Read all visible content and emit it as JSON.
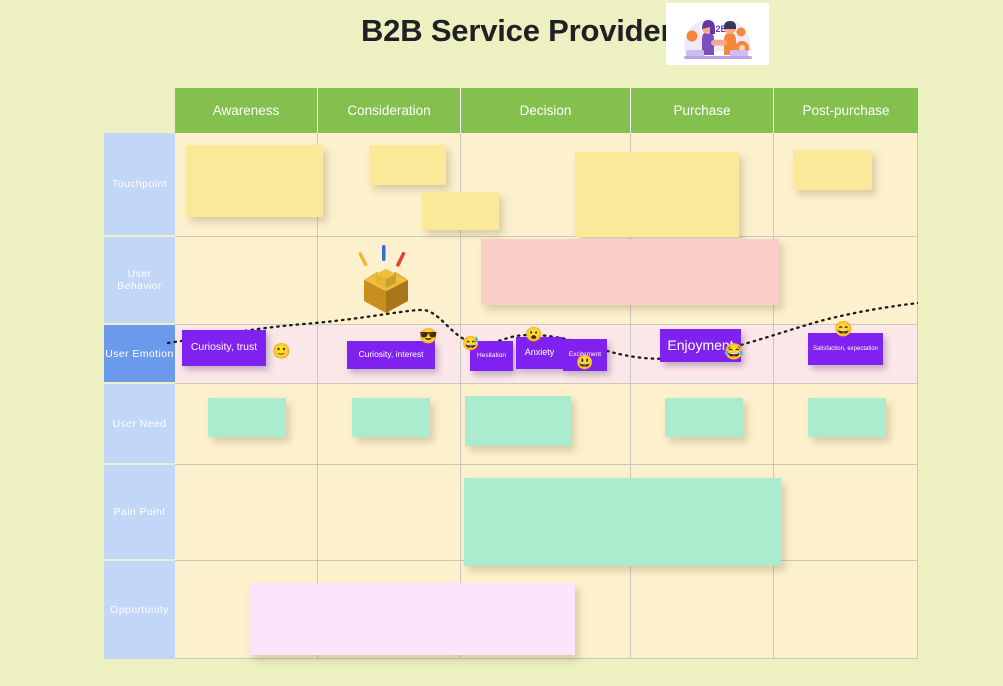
{
  "header": {
    "title": "B2B Service Provider",
    "logo_alt": "b2b-handshake-illustration",
    "logo_text": "B2B"
  },
  "board": {
    "columns": [
      {
        "label": "Awareness"
      },
      {
        "label": "Consideration"
      },
      {
        "label": "Decision"
      },
      {
        "label": "Purchase"
      },
      {
        "label": "Post-purchase"
      }
    ],
    "rows": [
      {
        "label": "Touchpoint",
        "active": false
      },
      {
        "label": "User  Behavior",
        "active": false
      },
      {
        "label": "User  Emotion",
        "active": true
      },
      {
        "label": "User  Need",
        "active": false
      },
      {
        "label": "Pain  Point",
        "active": false
      },
      {
        "label": "Opportunity",
        "active": false
      }
    ],
    "colors": {
      "canvas": "#edf0c0",
      "column_header": "#84c04e",
      "row_label": "#c2d6f8",
      "row_label_active": "#6b9aec",
      "cell": "#fdf0cd",
      "cell_emotion": "#fbe7e7",
      "note_yellow": "#fce899",
      "note_mint": "#abeccf",
      "note_pink": "#fbcdc8",
      "note_lavender": "#fde4fd",
      "emotion_card": "#7f22ef",
      "grid_line": "#c9c9be"
    }
  },
  "notes": {
    "touchpoint": [
      {
        "text": ""
      },
      {
        "text": ""
      },
      {
        "text": ""
      },
      {
        "text": ""
      },
      {
        "text": ""
      }
    ],
    "user_behavior": [
      {
        "text": ""
      }
    ],
    "user_need": [
      {
        "text": ""
      },
      {
        "text": ""
      },
      {
        "text": ""
      },
      {
        "text": ""
      },
      {
        "text": ""
      }
    ],
    "pain_point": [
      {
        "text": ""
      }
    ],
    "opportunity": [
      {
        "text": ""
      }
    ]
  },
  "emotions": [
    {
      "label": "Curiosity, trust",
      "emoji": "🙂"
    },
    {
      "label": "Curiosity, interest",
      "emoji": "😎"
    },
    {
      "label": "Hesitation",
      "emoji": "😅"
    },
    {
      "label": "Anxiety",
      "emoji": "😮"
    },
    {
      "label": "Excitement",
      "emoji": "😃"
    },
    {
      "label": "Enjoyment",
      "emoji": "😂"
    },
    {
      "label": "Satisfaction, expectation",
      "emoji": "😄"
    }
  ]
}
